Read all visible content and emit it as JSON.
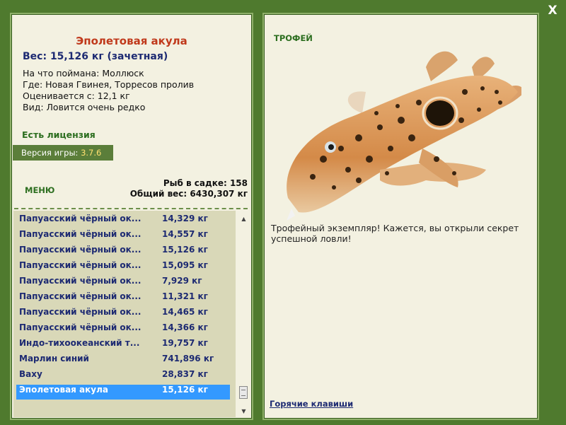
{
  "close_label": "X",
  "fish": {
    "name": "Эполетовая акула",
    "weight_line": "Вес: 15,126 кг (зачетная)",
    "info": [
      "На что поймана: Моллюск",
      "Где: Новая Гвинея, Торресов пролив",
      "Оценивается с: 12,1 кг",
      "Вид: Ловится очень редко"
    ]
  },
  "license_text": "Есть лицензия",
  "version": {
    "label": "Версия игры: ",
    "value": "3.7.6"
  },
  "menu_label": "МЕНЮ",
  "cage": {
    "count_line": "Рыб в садке: 158",
    "total_line": "Общий вес: 6430,307 кг"
  },
  "catch_list": [
    {
      "name": "Папуасский чёрный ок...",
      "weight": "14,329 кг"
    },
    {
      "name": "Папуасский чёрный ок...",
      "weight": "14,557 кг"
    },
    {
      "name": "Папуасский чёрный ок...",
      "weight": "15,126 кг"
    },
    {
      "name": "Папуасский чёрный ок...",
      "weight": "15,095 кг"
    },
    {
      "name": "Папуасский чёрный ок...",
      "weight": "7,929 кг"
    },
    {
      "name": "Папуасский чёрный ок...",
      "weight": "11,321 кг"
    },
    {
      "name": "Папуасский чёрный ок...",
      "weight": "14,465 кг"
    },
    {
      "name": "Папуасский чёрный ок...",
      "weight": "14,366 кг"
    },
    {
      "name": "Индо-тихоокеанский т...",
      "weight": "19,757 кг"
    },
    {
      "name": "Марлин синий",
      "weight": "741,896 кг"
    },
    {
      "name": "Ваху",
      "weight": "28,837 кг"
    },
    {
      "name": "Эполетовая акула",
      "weight": "15,126 кг",
      "selected": true
    }
  ],
  "trophy": {
    "title": "ТРОФЕЙ",
    "text": "Трофейный экземпляр! Кажется, вы открыли секрет успешной ловли!"
  },
  "hotkeys_label": "Горячие клавиши",
  "colors": {
    "frame": "#4f7a2e",
    "panel": "#f3f1e1",
    "list_bg": "#d9d8b8",
    "selection": "#3399ff",
    "fish_name": "#c0391b",
    "link": "#1d2a72"
  }
}
